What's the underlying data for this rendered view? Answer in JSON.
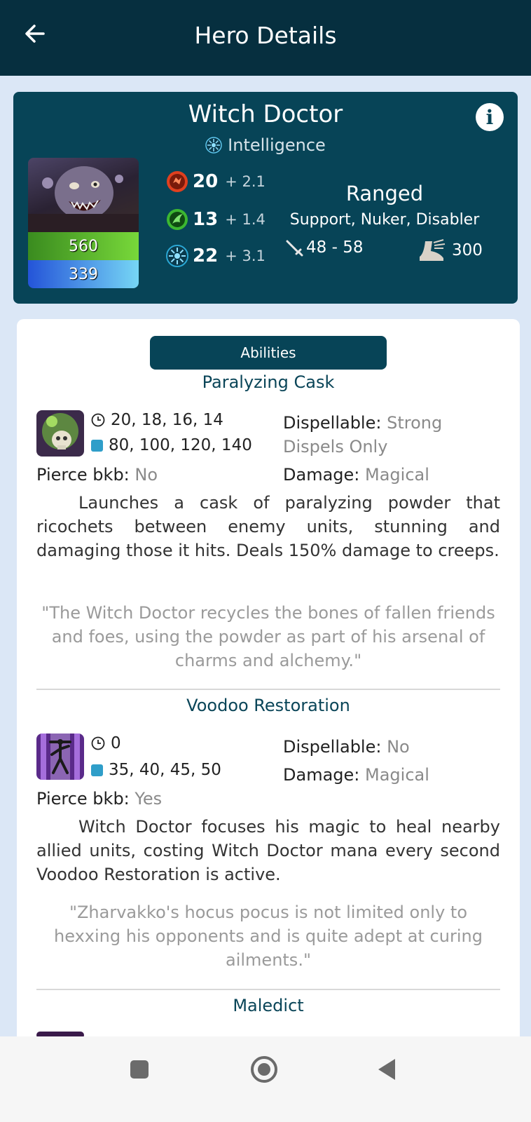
{
  "appbar": {
    "title": "Hero Details",
    "back_icon": "arrow-left-icon"
  },
  "hero": {
    "name": "Witch Doctor",
    "primary_attribute": "Intelligence",
    "health": "560",
    "mana": "339",
    "strength": {
      "base": "20",
      "gain": "+ 2.1"
    },
    "agility": {
      "base": "13",
      "gain": "+ 1.4"
    },
    "intelligence": {
      "base": "22",
      "gain": "+ 3.1"
    },
    "attack_type": "Ranged",
    "roles": "Support, Nuker, Disabler",
    "damage": "48 - 58",
    "move_speed": "300",
    "colors": {
      "header": "#062f3f",
      "card": "#074457",
      "strength": "#e0401f",
      "agility": "#3cb731",
      "intelligence": "#2aa7d4"
    }
  },
  "abilities_tab": {
    "label": "Abilities"
  },
  "abilities": [
    {
      "name": "Paralyzing Cask",
      "cooldown": "20, 18, 16, 14",
      "mana": "80, 100, 120, 140",
      "dispellable_label": "Dispellable:",
      "dispellable_value": "Strong",
      "dispellable_note": "Dispels Only",
      "pierce_label": "Pierce bkb:",
      "pierce_value": "No",
      "damage_label": "Damage:",
      "damage_value": "Magical",
      "description": "Launches a cask of paralyzing powder that ricochets between enemy units, stunning and damaging those it hits. Deals 150% damage to creeps.",
      "lore": "\"The Witch Doctor recycles the bones of fallen friends and foes, using the powder as part of his arsenal of charms and alchemy.\""
    },
    {
      "name": "Voodoo Restoration",
      "cooldown": "0",
      "mana": "35, 40, 45, 50",
      "dispellable_label": "Dispellable:",
      "dispellable_value": "No",
      "pierce_label": "Pierce bkb:",
      "pierce_value": "Yes",
      "damage_label": "Damage:",
      "damage_value": "Magical",
      "description": "Witch Doctor focuses his magic to heal nearby allied units, costing Witch Doctor mana every second Voodoo Restoration is active.",
      "lore": "\"Zharvakko's hocus pocus is not limited only to hexxing his opponents and is quite adept at curing ailments.\""
    },
    {
      "name": "Maledict"
    }
  ],
  "navbar": {
    "items": [
      "recents-button",
      "home-button",
      "back-button"
    ]
  }
}
